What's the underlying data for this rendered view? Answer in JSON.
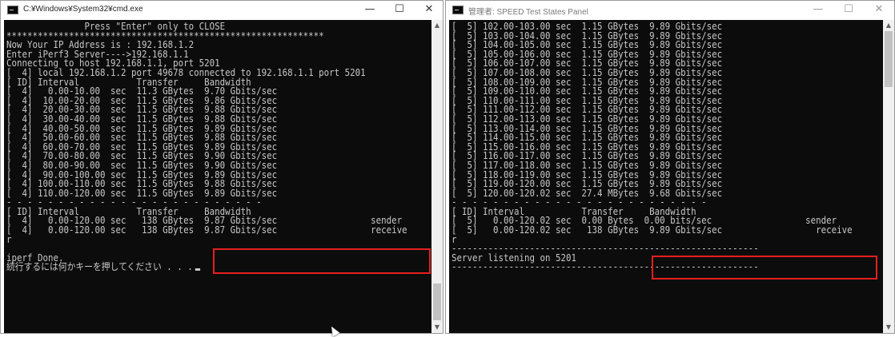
{
  "window_left": {
    "title": "C:¥Windows¥System32¥cmd.exe",
    "controls": {
      "minimize": "—",
      "maximize": "☐",
      "close": "✕"
    },
    "lines": [
      "               Press \"Enter\" only to CLOSE",
      "*************************************************************",
      "Now Your IP Address is : 192.168.1.2",
      "Enter iPerf3 Server---->192.168.1.1",
      "Connecting to host 192.168.1.1, port 5201",
      "[  4] local 192.168.1.2 port 49678 connected to 192.168.1.1 port 5201",
      "[ ID] Interval           Transfer     Bandwidth",
      "[  4]   0.00-10.00  sec  11.3 GBytes  9.70 Gbits/sec",
      "[  4]  10.00-20.00  sec  11.5 GBytes  9.86 Gbits/sec",
      "[  4]  20.00-30.00  sec  11.5 GBytes  9.88 Gbits/sec",
      "[  4]  30.00-40.00  sec  11.5 GBytes  9.88 Gbits/sec",
      "[  4]  40.00-50.00  sec  11.5 GBytes  9.89 Gbits/sec",
      "[  4]  50.00-60.00  sec  11.5 GBytes  9.88 Gbits/sec",
      "[  4]  60.00-70.00  sec  11.5 GBytes  9.89 Gbits/sec",
      "[  4]  70.00-80.00  sec  11.5 GBytes  9.90 Gbits/sec",
      "[  4]  80.00-90.00  sec  11.5 GBytes  9.90 Gbits/sec",
      "[  4]  90.00-100.00 sec  11.5 GBytes  9.89 Gbits/sec",
      "[  4] 100.00-110.00 sec  11.5 GBytes  9.88 Gbits/sec",
      "[  4] 110.00-120.00 sec  11.5 GBytes  9.89 Gbits/sec",
      "- - - - - - - - - - - - - - - - - - - - - - - - -",
      "[ ID] Interval           Transfer     Bandwidth",
      "[  4]   0.00-120.00 sec   138 GBytes  9.87 Gbits/sec                  sender",
      "[  4]   0.00-120.00 sec   138 GBytes  9.87 Gbits/sec                  receive",
      "r",
      "",
      "iperf Done.",
      "続行するには何かキーを押してください . . ."
    ]
  },
  "window_right": {
    "title": "管理者: SPEED Test States Panel",
    "controls": {
      "minimize": "—",
      "maximize": "☐",
      "close": "✕"
    },
    "lines": [
      "[  5] 102.00-103.00 sec  1.15 GBytes  9.89 Gbits/sec",
      "[  5] 103.00-104.00 sec  1.15 GBytes  9.89 Gbits/sec",
      "[  5] 104.00-105.00 sec  1.15 GBytes  9.89 Gbits/sec",
      "[  5] 105.00-106.00 sec  1.15 GBytes  9.89 Gbits/sec",
      "[  5] 106.00-107.00 sec  1.15 GBytes  9.89 Gbits/sec",
      "[  5] 107.00-108.00 sec  1.15 GBytes  9.89 Gbits/sec",
      "[  5] 108.00-109.00 sec  1.15 GBytes  9.89 Gbits/sec",
      "[  5] 109.00-110.00 sec  1.15 GBytes  9.89 Gbits/sec",
      "[  5] 110.00-111.00 sec  1.15 GBytes  9.89 Gbits/sec",
      "[  5] 111.00-112.00 sec  1.15 GBytes  9.89 Gbits/sec",
      "[  5] 112.00-113.00 sec  1.15 GBytes  9.89 Gbits/sec",
      "[  5] 113.00-114.00 sec  1.15 GBytes  9.89 Gbits/sec",
      "[  5] 114.00-115.00 sec  1.15 GBytes  9.89 Gbits/sec",
      "[  5] 115.00-116.00 sec  1.15 GBytes  9.89 Gbits/sec",
      "[  5] 116.00-117.00 sec  1.15 GBytes  9.89 Gbits/sec",
      "[  5] 117.00-118.00 sec  1.15 GBytes  9.89 Gbits/sec",
      "[  5] 118.00-119.00 sec  1.15 GBytes  9.89 Gbits/sec",
      "[  5] 119.00-120.00 sec  1.15 GBytes  9.89 Gbits/sec",
      "[  5] 120.00-120.02 sec  27.4 MBytes  9.68 Gbits/sec",
      "- - - - - - - - - - - - - - - - - - - - - - - - -",
      "[ ID] Interval           Transfer     Bandwidth",
      "[  5]   0.00-120.02 sec  0.00 Bytes  0.00 bits/sec                  sender",
      "[  5]   0.00-120.02 sec   138 GBytes  9.89 Gbits/sec                  receive",
      "r",
      "-----------------------------------------------------------",
      "Server listening on 5201",
      "-----------------------------------------------------------"
    ]
  },
  "colors": {
    "console_bg": "#0c0c0c",
    "console_text": "#c8c8c8",
    "highlight": "#e81e1e"
  }
}
